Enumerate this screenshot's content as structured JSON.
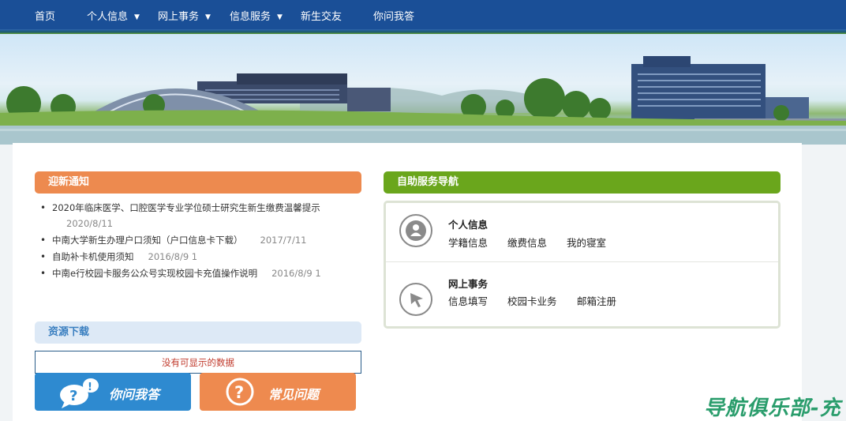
{
  "nav": {
    "items": [
      {
        "label": "首页",
        "dropdown": false
      },
      {
        "label": "个人信息",
        "dropdown": true
      },
      {
        "label": "网上事务",
        "dropdown": true
      },
      {
        "label": "信息服务",
        "dropdown": true
      },
      {
        "label": "新生交友",
        "dropdown": false
      },
      {
        "label": "你问我答",
        "dropdown": false
      }
    ]
  },
  "notice": {
    "title": "迎新通知",
    "items": [
      {
        "text": "2020年临床医学、口腔医学专业学位硕士研究生新生缴费温馨提示",
        "date": "2020/8/11"
      },
      {
        "text": "中南大学新生办理户口须知（户口信息卡下载）",
        "date": "2017/7/11"
      },
      {
        "text": "自助补卡机使用须知",
        "date": "2016/8/9 1"
      },
      {
        "text": "中南e行校园卡服务公众号实现校园卡充值操作说明",
        "date": "2016/8/9 1"
      }
    ]
  },
  "self_service": {
    "title": "自助服务导航",
    "groups": [
      {
        "title": "个人信息",
        "icon": "person-icon",
        "links": [
          "学籍信息",
          "缴费信息",
          "我的寝室"
        ]
      },
      {
        "title": "网上事务",
        "icon": "cursor-icon",
        "links": [
          "信息填写",
          "校园卡业务",
          "邮箱注册"
        ]
      }
    ]
  },
  "downloads": {
    "title": "资源下载",
    "empty_text": "没有可显示的数据"
  },
  "buttons": {
    "ask": "你问我答",
    "faq": "常见问题"
  },
  "watermark": "导航俱乐部-充",
  "colors": {
    "nav_bg": "#1a4f97",
    "notice_head": "#ed8a4f",
    "service_head": "#6aa61c",
    "download_head": "#dde9f6",
    "ask_button": "#2e8ad0",
    "faq_button": "#ee8a4f"
  }
}
